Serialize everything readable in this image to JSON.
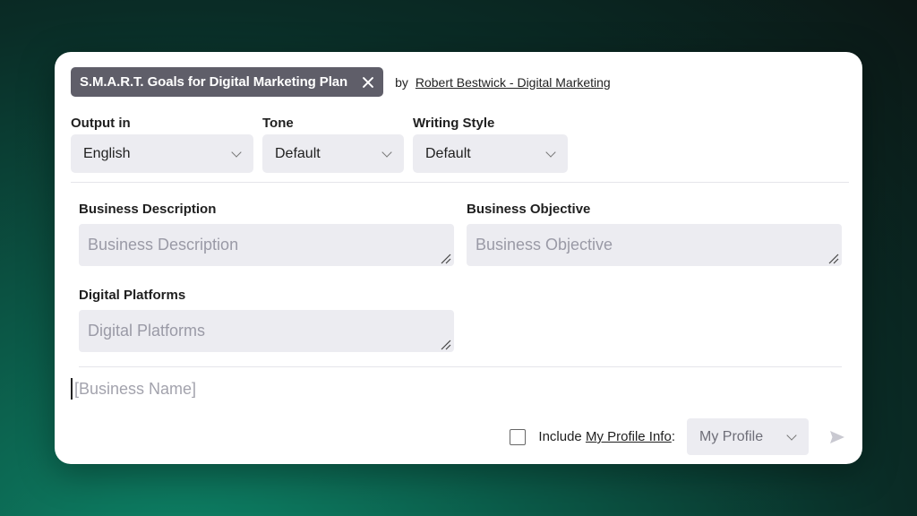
{
  "prompt": {
    "title": "S.M.A.R.T. Goals for Digital Marketing Plan",
    "by_label": "by",
    "author": "Robert Bestwick - Digital Marketing"
  },
  "selectors": {
    "output": {
      "label": "Output in",
      "value": "English"
    },
    "tone": {
      "label": "Tone",
      "value": "Default"
    },
    "style": {
      "label": "Writing Style",
      "value": "Default"
    }
  },
  "fields": {
    "business_description": {
      "label": "Business Description",
      "placeholder": "Business Description"
    },
    "business_objective": {
      "label": "Business Objective",
      "placeholder": "Business Objective"
    },
    "digital_platforms": {
      "label": "Digital Platforms",
      "placeholder": "Digital Platforms"
    }
  },
  "composer": {
    "placeholder": "[Business Name]"
  },
  "footer": {
    "include_prefix": "Include ",
    "include_link": "My Profile Info",
    "include_suffix": ":",
    "profile_select": "My Profile",
    "include_checked": false
  },
  "colors": {
    "tag_background": "#5f5e69",
    "field_background": "#ececf1",
    "background_accent": "#0f8a6c"
  }
}
